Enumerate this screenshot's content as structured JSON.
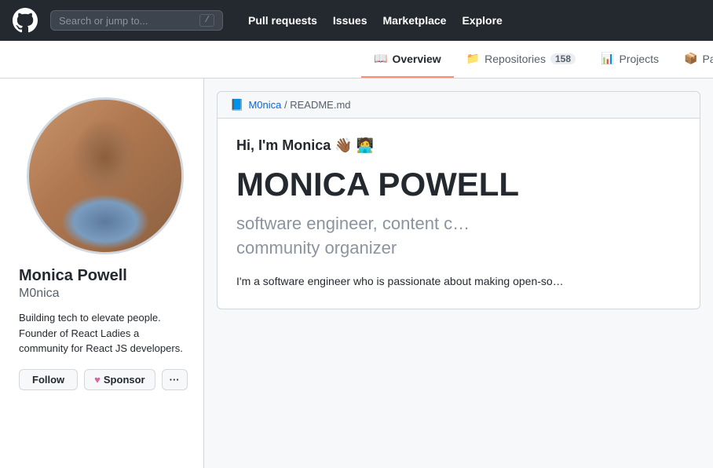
{
  "header": {
    "logo_alt": "GitHub",
    "search_placeholder": "Search or jump to...",
    "search_shortcut": "/",
    "nav": [
      {
        "label": "Pull requests",
        "href": "#"
      },
      {
        "label": "Issues",
        "href": "#"
      },
      {
        "label": "Marketplace",
        "href": "#"
      },
      {
        "label": "Explore",
        "href": "#"
      }
    ]
  },
  "tabs": [
    {
      "id": "overview",
      "label": "Overview",
      "icon": "📖",
      "active": true
    },
    {
      "id": "repositories",
      "label": "Repositories",
      "icon": "📁",
      "count": "158",
      "active": false
    },
    {
      "id": "projects",
      "label": "Projects",
      "icon": "📊",
      "active": false
    },
    {
      "id": "packages",
      "label": "Packages",
      "icon": "📦",
      "active": false
    }
  ],
  "profile": {
    "fullname": "Monica Powell",
    "username": "M0nica",
    "bio": "Building tech to elevate people. Founder of React Ladies a community for React JS developers.",
    "follow_label": "Follow",
    "sponsor_label": "Sponsor",
    "more_label": "···"
  },
  "readme": {
    "user": "M0nica",
    "file": "README.md",
    "greeting": "Hi, I'm Monica 👋🏾 🧑‍💻",
    "name_large": "MONICA POWELL",
    "tagline": "software engineer, content c…\ncommunity organizer",
    "bio_text": "I'm a software engineer who is passionate about making open-so…"
  }
}
